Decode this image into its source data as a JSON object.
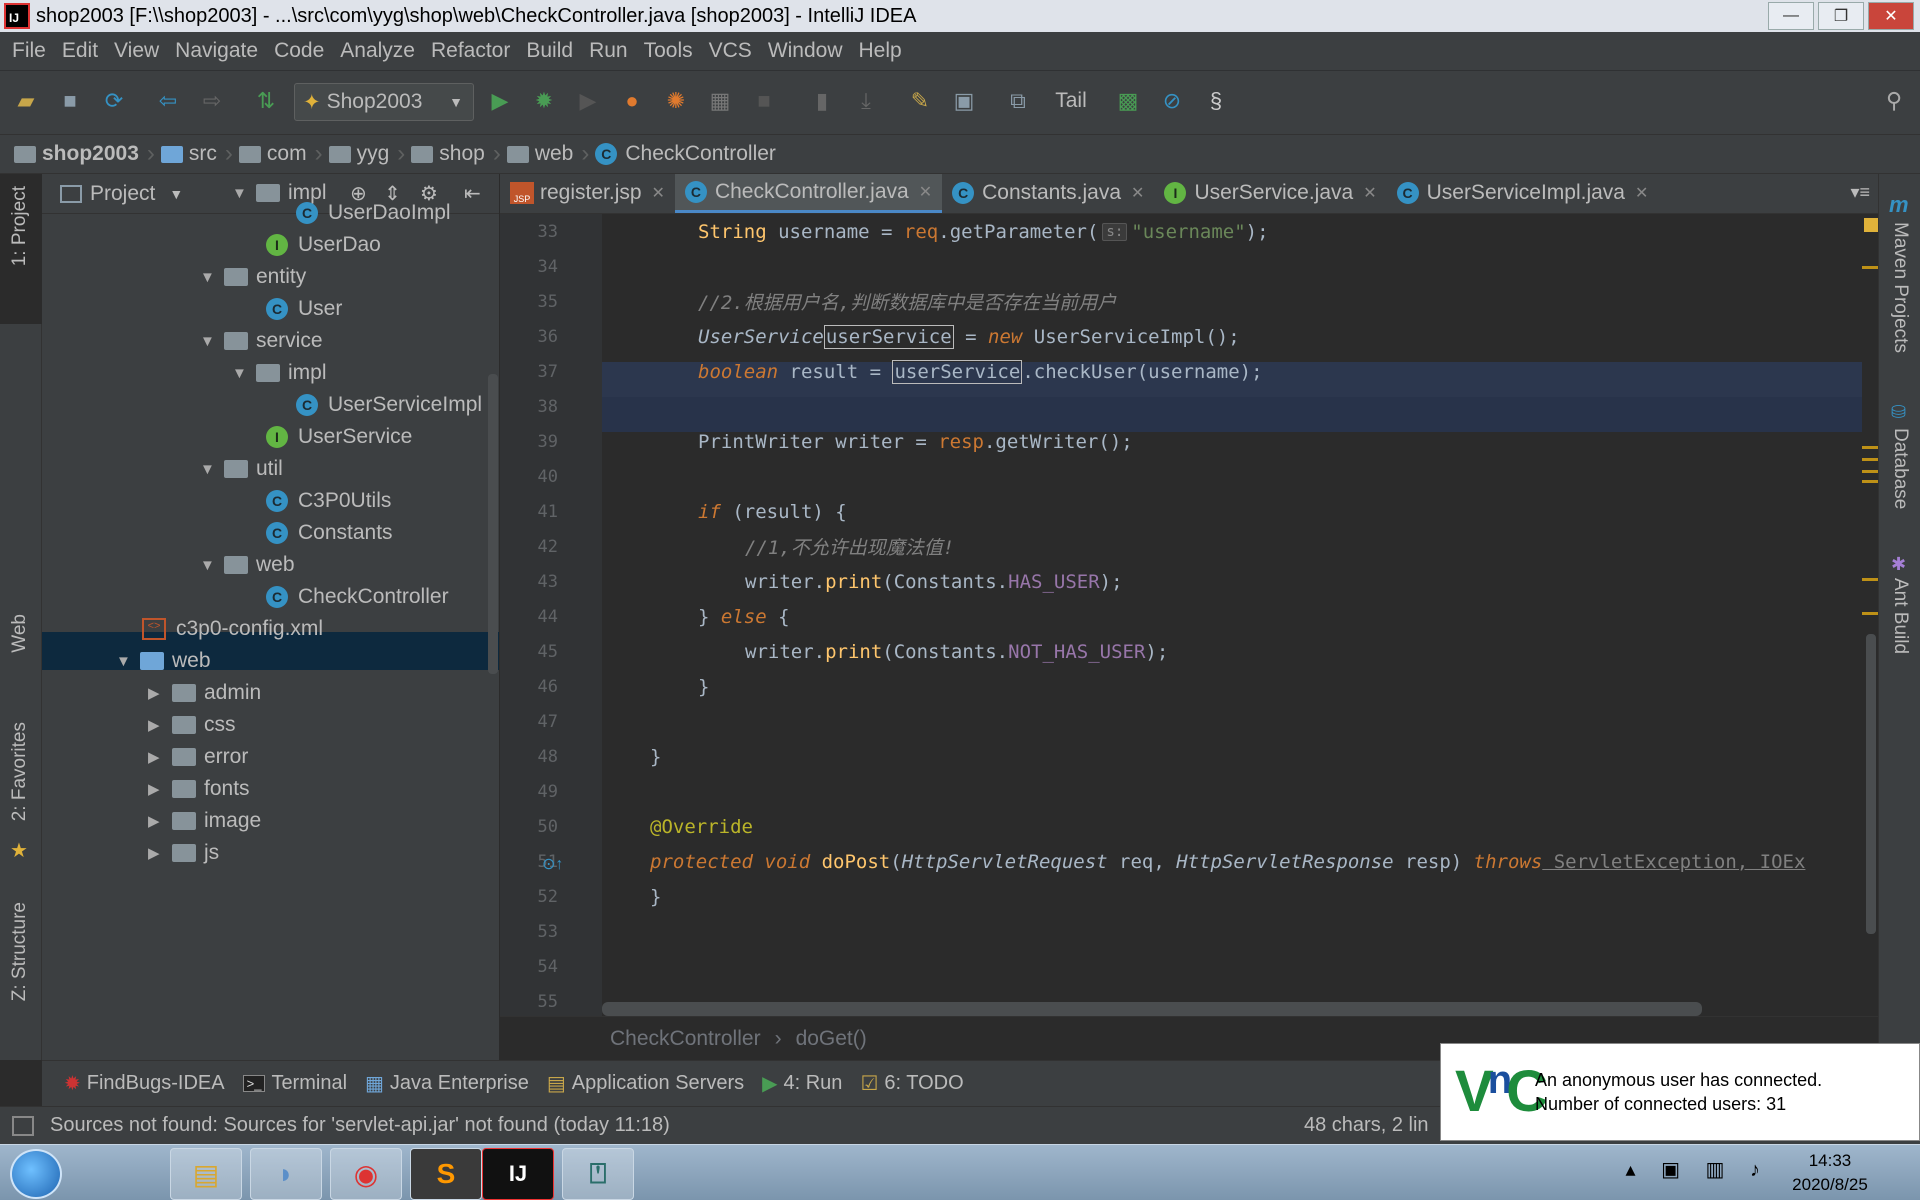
{
  "window": {
    "title": "shop2003 [F:\\\\shop2003] - ...\\src\\com\\yyg\\shop\\web\\CheckController.java [shop2003] - IntelliJ IDEA"
  },
  "menu": [
    "File",
    "Edit",
    "View",
    "Navigate",
    "Code",
    "Analyze",
    "Refactor",
    "Build",
    "Run",
    "Tools",
    "VCS",
    "Window",
    "Help"
  ],
  "toolbar": {
    "run_config": "Shop2003",
    "tail_label": "Tail"
  },
  "breadcrumb": [
    "shop2003",
    "src",
    "com",
    "yyg",
    "shop",
    "web",
    "CheckController"
  ],
  "left_stripe": {
    "project": "1: Project",
    "web": "Web",
    "favorites": "2: Favorites",
    "structure": "Z: Structure"
  },
  "project": {
    "title": "Project",
    "tree": [
      {
        "label": "impl",
        "type": "folder",
        "arrow": "▼"
      },
      {
        "label": "UserDaoImpl",
        "type": "class"
      },
      {
        "label": "UserDao",
        "type": "interface"
      },
      {
        "label": "entity",
        "type": "folder",
        "arrow": "▼"
      },
      {
        "label": "User",
        "type": "class"
      },
      {
        "label": "service",
        "type": "folder",
        "arrow": "▼"
      },
      {
        "label": "impl",
        "type": "folder",
        "arrow": "▼"
      },
      {
        "label": "UserServiceImpl",
        "type": "class"
      },
      {
        "label": "UserService",
        "type": "interface"
      },
      {
        "label": "util",
        "type": "folder",
        "arrow": "▼"
      },
      {
        "label": "C3P0Utils",
        "type": "class"
      },
      {
        "label": "Constants",
        "type": "class",
        "selected": true
      },
      {
        "label": "web",
        "type": "folder",
        "arrow": "▼"
      },
      {
        "label": "CheckController",
        "type": "class"
      },
      {
        "label": "c3p0-config.xml",
        "type": "xml"
      },
      {
        "label": "web",
        "type": "folder-blue",
        "arrow": "▼"
      },
      {
        "label": "admin",
        "type": "folder",
        "arrow": "▶"
      },
      {
        "label": "css",
        "type": "folder",
        "arrow": "▶"
      },
      {
        "label": "error",
        "type": "folder",
        "arrow": "▶"
      },
      {
        "label": "fonts",
        "type": "folder",
        "arrow": "▶"
      },
      {
        "label": "image",
        "type": "folder",
        "arrow": "▶"
      },
      {
        "label": "js",
        "type": "folder",
        "arrow": "▶"
      }
    ]
  },
  "tabs": [
    {
      "label": "register.jsp",
      "icon": "jsp"
    },
    {
      "label": "CheckController.java",
      "icon": "class",
      "active": true
    },
    {
      "label": "Constants.java",
      "icon": "class"
    },
    {
      "label": "UserService.java",
      "icon": "interface"
    },
    {
      "label": "UserServiceImpl.java",
      "icon": "class"
    }
  ],
  "editor": {
    "line_numbers": [
      "33",
      "34",
      "35",
      "36",
      "37",
      "38",
      "39",
      "40",
      "41",
      "42",
      "43",
      "44",
      "45",
      "46",
      "47",
      "48",
      "49",
      "50",
      "51",
      "52",
      "53",
      "54",
      "55"
    ],
    "code": {
      "l33_a": "String",
      "l33_b": " username = ",
      "l33_c": "req",
      "l33_d": ".getParameter(",
      "l33_tag": "s:",
      "l33_e": "\"username\"",
      "l33_f": ");",
      "l35": "//2.根据用户名,判断数据库中是否存在当前用户",
      "l36_a": "UserService",
      "l36_b": "userService",
      "l36_c": " = ",
      "l36_d": "new",
      "l36_e": " UserServiceImpl();",
      "l37_a": "boolean",
      "l37_b": " result = ",
      "l37_c": "userService",
      "l37_d": ".checkUser(username);",
      "l39_a": "PrintWriter writer = ",
      "l39_b": "resp",
      "l39_c": ".getWriter();",
      "l41_a": "if",
      "l41_b": " (result) {",
      "l42": "//1,不允许出现魔法值!",
      "l43_a": "writer.",
      "l43_b": "print",
      "l43_c": "(Constants.",
      "l43_d": "HAS_USER",
      "l43_e": ");",
      "l44_a": "} ",
      "l44_b": "else",
      "l44_c": " {",
      "l45_a": "writer.",
      "l45_b": "print",
      "l45_c": "(Constants.",
      "l45_d": "NOT_HAS_USER",
      "l45_e": ");",
      "l46": "}",
      "l48": "}",
      "l50": "@Override",
      "l51_a": "protected",
      "l51_b": " void ",
      "l51_c": "doPost",
      "l51_d": "(",
      "l51_e": "HttpServletRequest",
      "l51_f": " req, ",
      "l51_g": "HttpServletResponse",
      "l51_h": " resp) ",
      "l51_i": "throws",
      "l51_j": " ServletException, IOEx",
      "l53": "}"
    },
    "footer_crumbs": [
      "CheckController",
      "doGet()"
    ]
  },
  "right_stripe": {
    "maven": "Maven Projects",
    "database": "Database",
    "ant": "Ant Build"
  },
  "tool_windows": [
    "FindBugs-IDEA",
    "Terminal",
    "Java Enterprise",
    "Application Servers",
    "4: Run",
    "6: TODO"
  ],
  "status": {
    "message": "Sources not found: Sources for 'servlet-api.jar' not found (today 11:18)",
    "position": "48 chars, 2 lin"
  },
  "vnc": {
    "line1": "An anonymous user has connected.",
    "line2": "Number of connected users: 31"
  },
  "taskbar": {
    "time": "14:33",
    "date": "2020/8/25"
  },
  "colors": {
    "editor_bg": "#2b2b2b",
    "panel_bg": "#3c3f41",
    "keyword": "#cc7832",
    "string": "#6a8759",
    "accent": "#4a88c7"
  }
}
